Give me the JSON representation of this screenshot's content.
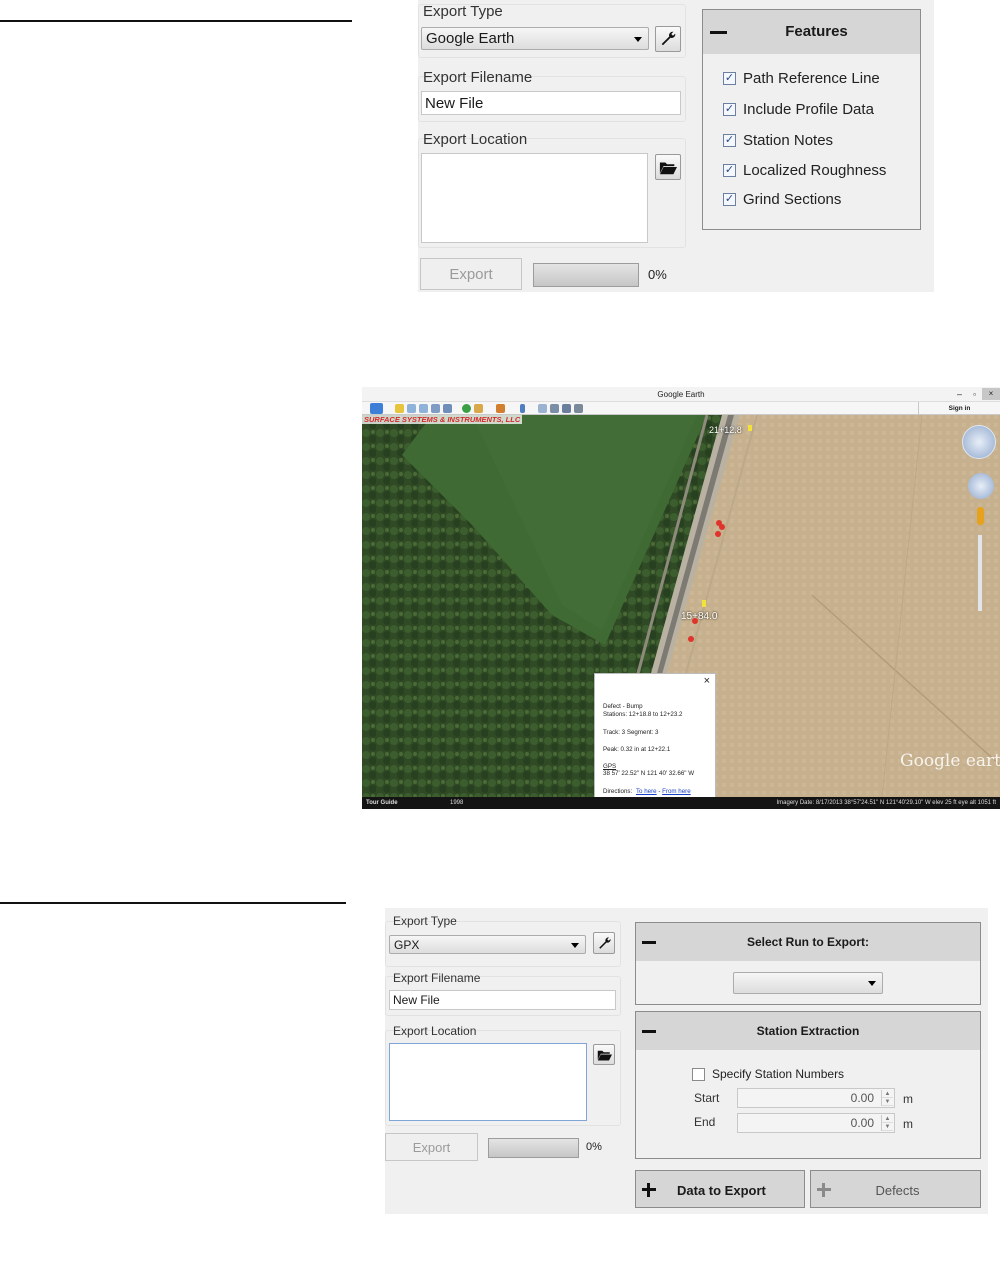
{
  "panel1": {
    "export_type_label": "Export Type",
    "export_type_value": "Google Earth",
    "export_filename_label": "Export Filename",
    "export_filename_value": "New File",
    "export_location_label": "Export Location",
    "export_button": "Export",
    "progress_percent": "0%",
    "progress_value": 0,
    "features": {
      "title": "Features",
      "items": [
        {
          "label": "Path Reference Line",
          "checked": true
        },
        {
          "label": "Include Profile Data",
          "checked": true
        },
        {
          "label": "Station Notes",
          "checked": true
        },
        {
          "label": "Localized Roughness",
          "checked": true
        },
        {
          "label": "Grind Sections",
          "checked": true
        }
      ]
    }
  },
  "google_earth": {
    "title": "Google Earth",
    "sign_in": "Sign in",
    "watermark": "SURFACE SYSTEMS & INSTRUMENTS, LLC",
    "station_top": "21+12.8",
    "station_mid": "15+84.0",
    "logo": "Google earth",
    "tour_guide": "Tour Guide",
    "year": "1998",
    "status_text": "Imagery Date: 8/17/2013    38°57'24.51\" N 121°40'29.10\" W  elev  25 ft     eye alt  1051 ft",
    "popup": {
      "close": "×",
      "line1": "Defect - Bump",
      "line2": "Stations: 12+18.8 to 12+23.2",
      "line3": "Track: 3 Segment: 3",
      "line4": "Peak: 0.32 in at 12+22.1",
      "line5": "GPS",
      "line6": "38 57' 22.52\" N 121 40' 32.66\" W",
      "directions": "Directions:",
      "to_here": "To here",
      "sep": " - ",
      "from_here": "From here"
    }
  },
  "panel2": {
    "export_type_label": "Export Type",
    "export_type_value": "GPX",
    "export_filename_label": "Export Filename",
    "export_filename_value": "New File",
    "export_location_label": "Export Location",
    "export_button": "Export",
    "progress_percent": "0%",
    "progress_value": 0,
    "select_run_title": "Select Run to Export:",
    "select_run_value": "",
    "station_title": "Station Extraction",
    "specify_label": "Specify Station Numbers",
    "specify_checked": false,
    "start_label": "Start",
    "start_value": "0.00",
    "end_label": "End",
    "end_value": "0.00",
    "unit": "m",
    "data_to_export": "Data to Export",
    "defects": "Defects"
  },
  "colors": {
    "panel_bg": "#f0f0f0",
    "header_bg": "#d6d6d6",
    "popup_link": "#1a3fc4",
    "watermark": "#d42a2a"
  }
}
